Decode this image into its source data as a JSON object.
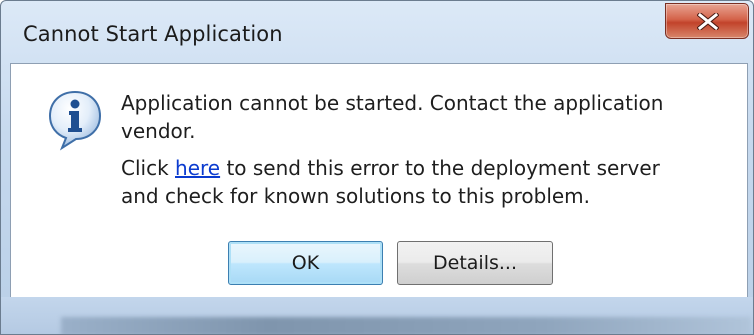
{
  "window": {
    "title": "Cannot Start Application",
    "close_glyph": "X"
  },
  "dialog": {
    "icon": "info-icon",
    "message_line1": "Application cannot be started. Contact the application",
    "message_line2": "vendor.",
    "detail_prefix": "Click ",
    "detail_link": "here",
    "detail_suffix": " to send this error to the deployment server",
    "detail_line2": "and check for known solutions to this problem."
  },
  "buttons": {
    "ok_label": "OK",
    "details_label": "Details..."
  },
  "colors": {
    "link": "#0b3bcf",
    "close_button": "#c2432b",
    "frame": "#c6d9ee"
  }
}
